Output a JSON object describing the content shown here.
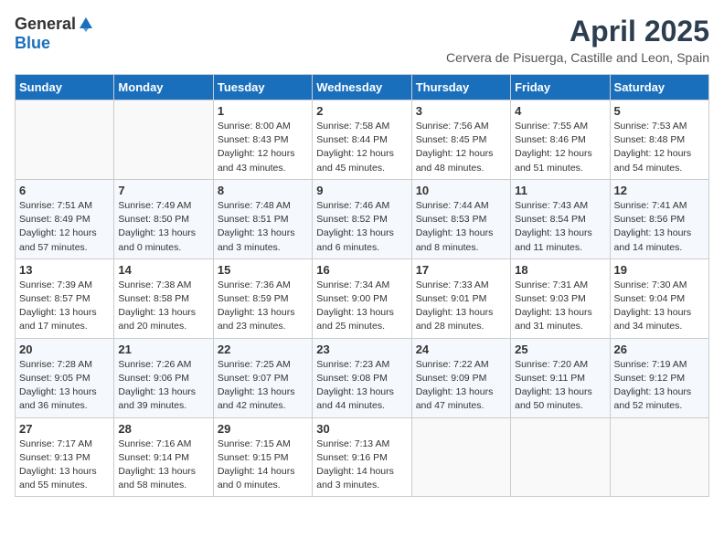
{
  "logo": {
    "general": "General",
    "blue": "Blue"
  },
  "title": "April 2025",
  "location": "Cervera de Pisuerga, Castille and Leon, Spain",
  "days_of_week": [
    "Sunday",
    "Monday",
    "Tuesday",
    "Wednesday",
    "Thursday",
    "Friday",
    "Saturday"
  ],
  "weeks": [
    [
      {
        "day": "",
        "sunrise": "",
        "sunset": "",
        "daylight": ""
      },
      {
        "day": "",
        "sunrise": "",
        "sunset": "",
        "daylight": ""
      },
      {
        "day": "1",
        "sunrise": "Sunrise: 8:00 AM",
        "sunset": "Sunset: 8:43 PM",
        "daylight": "Daylight: 12 hours and 43 minutes."
      },
      {
        "day": "2",
        "sunrise": "Sunrise: 7:58 AM",
        "sunset": "Sunset: 8:44 PM",
        "daylight": "Daylight: 12 hours and 45 minutes."
      },
      {
        "day": "3",
        "sunrise": "Sunrise: 7:56 AM",
        "sunset": "Sunset: 8:45 PM",
        "daylight": "Daylight: 12 hours and 48 minutes."
      },
      {
        "day": "4",
        "sunrise": "Sunrise: 7:55 AM",
        "sunset": "Sunset: 8:46 PM",
        "daylight": "Daylight: 12 hours and 51 minutes."
      },
      {
        "day": "5",
        "sunrise": "Sunrise: 7:53 AM",
        "sunset": "Sunset: 8:48 PM",
        "daylight": "Daylight: 12 hours and 54 minutes."
      }
    ],
    [
      {
        "day": "6",
        "sunrise": "Sunrise: 7:51 AM",
        "sunset": "Sunset: 8:49 PM",
        "daylight": "Daylight: 12 hours and 57 minutes."
      },
      {
        "day": "7",
        "sunrise": "Sunrise: 7:49 AM",
        "sunset": "Sunset: 8:50 PM",
        "daylight": "Daylight: 13 hours and 0 minutes."
      },
      {
        "day": "8",
        "sunrise": "Sunrise: 7:48 AM",
        "sunset": "Sunset: 8:51 PM",
        "daylight": "Daylight: 13 hours and 3 minutes."
      },
      {
        "day": "9",
        "sunrise": "Sunrise: 7:46 AM",
        "sunset": "Sunset: 8:52 PM",
        "daylight": "Daylight: 13 hours and 6 minutes."
      },
      {
        "day": "10",
        "sunrise": "Sunrise: 7:44 AM",
        "sunset": "Sunset: 8:53 PM",
        "daylight": "Daylight: 13 hours and 8 minutes."
      },
      {
        "day": "11",
        "sunrise": "Sunrise: 7:43 AM",
        "sunset": "Sunset: 8:54 PM",
        "daylight": "Daylight: 13 hours and 11 minutes."
      },
      {
        "day": "12",
        "sunrise": "Sunrise: 7:41 AM",
        "sunset": "Sunset: 8:56 PM",
        "daylight": "Daylight: 13 hours and 14 minutes."
      }
    ],
    [
      {
        "day": "13",
        "sunrise": "Sunrise: 7:39 AM",
        "sunset": "Sunset: 8:57 PM",
        "daylight": "Daylight: 13 hours and 17 minutes."
      },
      {
        "day": "14",
        "sunrise": "Sunrise: 7:38 AM",
        "sunset": "Sunset: 8:58 PM",
        "daylight": "Daylight: 13 hours and 20 minutes."
      },
      {
        "day": "15",
        "sunrise": "Sunrise: 7:36 AM",
        "sunset": "Sunset: 8:59 PM",
        "daylight": "Daylight: 13 hours and 23 minutes."
      },
      {
        "day": "16",
        "sunrise": "Sunrise: 7:34 AM",
        "sunset": "Sunset: 9:00 PM",
        "daylight": "Daylight: 13 hours and 25 minutes."
      },
      {
        "day": "17",
        "sunrise": "Sunrise: 7:33 AM",
        "sunset": "Sunset: 9:01 PM",
        "daylight": "Daylight: 13 hours and 28 minutes."
      },
      {
        "day": "18",
        "sunrise": "Sunrise: 7:31 AM",
        "sunset": "Sunset: 9:03 PM",
        "daylight": "Daylight: 13 hours and 31 minutes."
      },
      {
        "day": "19",
        "sunrise": "Sunrise: 7:30 AM",
        "sunset": "Sunset: 9:04 PM",
        "daylight": "Daylight: 13 hours and 34 minutes."
      }
    ],
    [
      {
        "day": "20",
        "sunrise": "Sunrise: 7:28 AM",
        "sunset": "Sunset: 9:05 PM",
        "daylight": "Daylight: 13 hours and 36 minutes."
      },
      {
        "day": "21",
        "sunrise": "Sunrise: 7:26 AM",
        "sunset": "Sunset: 9:06 PM",
        "daylight": "Daylight: 13 hours and 39 minutes."
      },
      {
        "day": "22",
        "sunrise": "Sunrise: 7:25 AM",
        "sunset": "Sunset: 9:07 PM",
        "daylight": "Daylight: 13 hours and 42 minutes."
      },
      {
        "day": "23",
        "sunrise": "Sunrise: 7:23 AM",
        "sunset": "Sunset: 9:08 PM",
        "daylight": "Daylight: 13 hours and 44 minutes."
      },
      {
        "day": "24",
        "sunrise": "Sunrise: 7:22 AM",
        "sunset": "Sunset: 9:09 PM",
        "daylight": "Daylight: 13 hours and 47 minutes."
      },
      {
        "day": "25",
        "sunrise": "Sunrise: 7:20 AM",
        "sunset": "Sunset: 9:11 PM",
        "daylight": "Daylight: 13 hours and 50 minutes."
      },
      {
        "day": "26",
        "sunrise": "Sunrise: 7:19 AM",
        "sunset": "Sunset: 9:12 PM",
        "daylight": "Daylight: 13 hours and 52 minutes."
      }
    ],
    [
      {
        "day": "27",
        "sunrise": "Sunrise: 7:17 AM",
        "sunset": "Sunset: 9:13 PM",
        "daylight": "Daylight: 13 hours and 55 minutes."
      },
      {
        "day": "28",
        "sunrise": "Sunrise: 7:16 AM",
        "sunset": "Sunset: 9:14 PM",
        "daylight": "Daylight: 13 hours and 58 minutes."
      },
      {
        "day": "29",
        "sunrise": "Sunrise: 7:15 AM",
        "sunset": "Sunset: 9:15 PM",
        "daylight": "Daylight: 14 hours and 0 minutes."
      },
      {
        "day": "30",
        "sunrise": "Sunrise: 7:13 AM",
        "sunset": "Sunset: 9:16 PM",
        "daylight": "Daylight: 14 hours and 3 minutes."
      },
      {
        "day": "",
        "sunrise": "",
        "sunset": "",
        "daylight": ""
      },
      {
        "day": "",
        "sunrise": "",
        "sunset": "",
        "daylight": ""
      },
      {
        "day": "",
        "sunrise": "",
        "sunset": "",
        "daylight": ""
      }
    ]
  ]
}
